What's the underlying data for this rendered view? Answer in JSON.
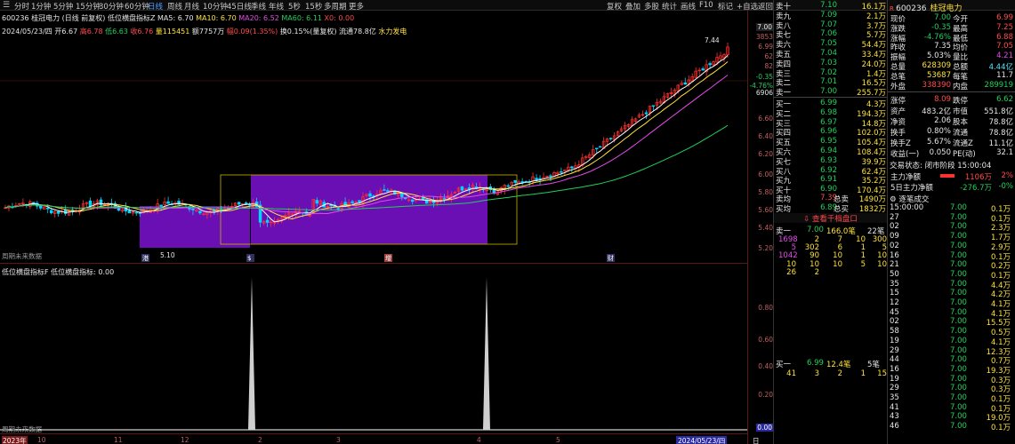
{
  "toolbar": {
    "periods": [
      "分时",
      "1分钟",
      "5分钟",
      "15分钟",
      "30分钟",
      "60分钟",
      "日线",
      "周线",
      "月线",
      "10分钟",
      "45日线",
      "季线",
      "年线",
      "5秒",
      "15秒",
      "多周期",
      "更多"
    ],
    "active": "日线",
    "right_tools": [
      "复权",
      "叠加",
      "多股",
      "统计",
      "画线",
      "F10",
      "标记",
      "+自选",
      "返回"
    ]
  },
  "chart_title": {
    "code": "600236",
    "name": "桂冠电力",
    "mode": "(日线 前复权)",
    "indicator": "低位横盘指标Z",
    "ma5": "MA5: 6.70",
    "ma10": "MA10: 6.70",
    "ma20": "MA20: 6.52",
    "ma60": "MA60: 6.11",
    "extra": "X0: 0.00"
  },
  "ohlc": {
    "date": "2024/05/23/四",
    "open": "开6.67",
    "high": "高6.78",
    "low": "低6.63",
    "close": "收6.76",
    "vol": "量115451",
    "amt": "额7757万",
    "chg": "幅0.09(1.35%)",
    "turn": "换0.15%(量复权)",
    "flow": "流通78.8亿",
    "sector": "水力发电"
  },
  "annotations": {
    "high": "7.44",
    "low": "5.10"
  },
  "event_marks": [
    "港",
    "$",
    "增",
    "财"
  ],
  "main_footer": "周期未来数据",
  "sub_title": "低位横盘指标F  低位横盘指标: 0.00",
  "sub_footer": "周期未来数据",
  "price_axis": {
    "top": "7.00",
    "labels": [
      "6.99",
      "6.60",
      "6.40",
      "6.20",
      "6.00",
      "5.80",
      "5.60",
      "5.40",
      "5.20"
    ],
    "pct": [
      "-0.35",
      "-4.76%"
    ],
    "small": [
      "3853",
      "62",
      "82"
    ],
    "vol_label": "6906"
  },
  "sub_axis": {
    "labels": [
      "0.80",
      "0.60",
      "0.40",
      "0.20",
      "0.00"
    ]
  },
  "time_axis": {
    "start": "2023年",
    "labels": [
      "10",
      "11",
      "12",
      "2",
      "3",
      "4",
      "5"
    ],
    "end": "2024/05/23/四",
    "period": "日线"
  },
  "orderbook": {
    "sells": [
      {
        "label": "卖十",
        "price": "7.10",
        "vol": "16.1万"
      },
      {
        "label": "卖九",
        "price": "7.09",
        "vol": "2.1万"
      },
      {
        "label": "卖八",
        "price": "7.07",
        "vol": "3.7万"
      },
      {
        "label": "卖七",
        "price": "7.06",
        "vol": "5.7万"
      },
      {
        "label": "卖六",
        "price": "7.05",
        "vol": "54.4万"
      },
      {
        "label": "卖五",
        "price": "7.04",
        "vol": "33.4万"
      },
      {
        "label": "卖四",
        "price": "7.03",
        "vol": "24.0万"
      },
      {
        "label": "卖三",
        "price": "7.02",
        "vol": "1.4万"
      },
      {
        "label": "卖二",
        "price": "7.01",
        "vol": "16.5万"
      },
      {
        "label": "卖一",
        "price": "7.00",
        "vol": "255.7万"
      }
    ],
    "buys": [
      {
        "label": "买一",
        "price": "6.99",
        "vol": "4.3万"
      },
      {
        "label": "买二",
        "price": "6.98",
        "vol": "194.3万"
      },
      {
        "label": "买三",
        "price": "6.97",
        "vol": "14.8万"
      },
      {
        "label": "买四",
        "price": "6.96",
        "vol": "102.0万"
      },
      {
        "label": "买五",
        "price": "6.95",
        "vol": "105.4万"
      },
      {
        "label": "买六",
        "price": "6.94",
        "vol": "108.4万"
      },
      {
        "label": "买七",
        "price": "6.93",
        "vol": "39.9万"
      },
      {
        "label": "买八",
        "price": "6.92",
        "price_color": "",
        "vol": "62.4万"
      },
      {
        "label": "买九",
        "price": "6.91",
        "vol": "35.2万"
      },
      {
        "label": "买十",
        "price": "6.90",
        "vol": "170.4万"
      }
    ],
    "avg": [
      {
        "label": "卖均",
        "price": "7.39",
        "tlabel": "总卖",
        "total": "1490万"
      },
      {
        "label": "买均",
        "price": "6.89",
        "tlabel": "总买",
        "total": "1832万"
      }
    ],
    "button": "查看千档盘口",
    "queue_head": {
      "label": "卖一",
      "price": "7.00",
      "vol": "166.0笔",
      "count": "22笔"
    },
    "queue": [
      [
        "1698",
        "2",
        "7",
        "10",
        "300"
      ],
      [
        "5",
        "302",
        "6",
        "1",
        "5"
      ],
      [
        "1042",
        "90",
        "10",
        "1",
        "10"
      ],
      [
        "10",
        "10",
        "10",
        "5",
        "10"
      ],
      [
        "26",
        "2",
        "",
        "",
        ""
      ]
    ],
    "queue2_head": {
      "label": "买一",
      "price": "6.99",
      "vol": "12.4笔",
      "count": "5笔"
    },
    "queue2": [
      [
        "41",
        "3",
        "2",
        "1",
        "15"
      ]
    ]
  },
  "quote": {
    "code": "600236",
    "name": "桂冠电力",
    "rows": [
      [
        "现价",
        "7.00",
        "今开",
        "6.99"
      ],
      [
        "涨跌",
        "-0.35",
        "最高",
        "7.25"
      ],
      [
        "涨幅",
        "-4.76%",
        "最低",
        "6.88"
      ],
      [
        "昨收",
        "7.35",
        "均价",
        "7.05"
      ],
      [
        "振幅",
        "5.03%",
        "量比",
        "4.21"
      ],
      [
        "总量",
        "628309",
        "总额",
        "4.44亿"
      ],
      [
        "总笔",
        "53687",
        "每笔",
        "11.7"
      ],
      [
        "外盘",
        "338390",
        "内盘",
        "289919"
      ]
    ],
    "fin": [
      [
        "涨停",
        "8.09",
        "跌停",
        "6.62"
      ],
      [
        "资产",
        "483.2亿",
        "市值",
        "551.8亿"
      ],
      [
        "净资",
        "2.06",
        "股本",
        "78.8亿"
      ],
      [
        "换手",
        "0.80%",
        "流通",
        "78.8亿"
      ],
      [
        "换手Z",
        "5.67%",
        "流通Z",
        "11.1亿"
      ],
      [
        "收益(一)",
        "0.050",
        "PE(动)",
        "32.1"
      ]
    ],
    "status": "交易状态: 闭市阶段 15:00:04",
    "flows": [
      {
        "label": "主力净额",
        "value": "1106万",
        "pct": "2%"
      },
      {
        "label": "5日主力净额",
        "value": "-276.7万",
        "pct": "-0%"
      }
    ],
    "ticks_title": "逐笔成交",
    "ticks": [
      [
        "15:00:00",
        "7.00",
        "0.1万"
      ],
      [
        "",
        "7.00",
        "0.1万"
      ],
      [
        "",
        "7.00",
        "2.3万"
      ],
      [
        "",
        "7.00",
        "1.7万"
      ],
      [
        "",
        "7.00",
        "2.9万"
      ],
      [
        "",
        "7.00",
        "0.1万"
      ],
      [
        "",
        "7.00",
        "0.2万"
      ],
      [
        "",
        "7.00",
        "0.1万"
      ],
      [
        "",
        "7.00",
        "4.4万"
      ],
      [
        "",
        "7.00",
        "4.2万"
      ],
      [
        "",
        "7.00",
        "4.1万"
      ],
      [
        "",
        "7.00",
        "4.1万"
      ],
      [
        "",
        "7.00",
        "15.5万"
      ],
      [
        "",
        "7.00",
        "0.5万"
      ],
      [
        "",
        "7.00",
        "4.1万"
      ],
      [
        "",
        "7.00",
        "12.3万"
      ],
      [
        "",
        "7.00",
        "0.7万"
      ],
      [
        "",
        "7.00",
        "19.3万"
      ],
      [
        "",
        "7.00",
        "0.3万"
      ],
      [
        "",
        "7.00",
        "0.3万"
      ],
      [
        "",
        "7.00",
        "0.1万"
      ],
      [
        "",
        "7.00",
        "0.1万"
      ],
      [
        "",
        "7.00",
        "19.0万"
      ],
      [
        "",
        "7.00",
        "0.1万"
      ]
    ],
    "tick_times": [
      "15:00:00",
      "27",
      "02",
      "09",
      "02",
      "16",
      "21",
      "50",
      "35",
      "15",
      "12",
      "45",
      "02",
      "58",
      "19",
      "29",
      "44",
      "16",
      "19",
      "29",
      "35",
      "41",
      "43",
      "46"
    ]
  }
}
